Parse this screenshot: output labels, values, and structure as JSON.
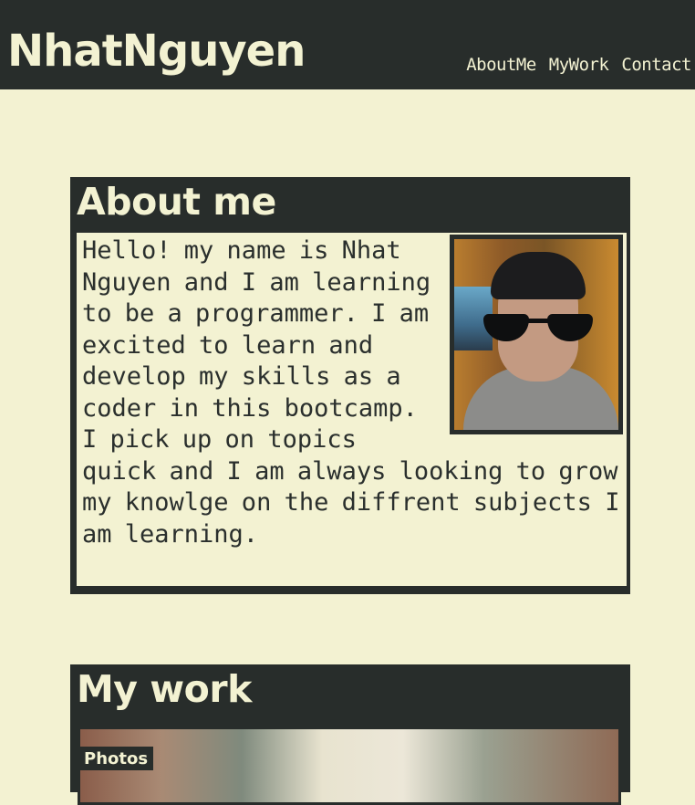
{
  "header": {
    "title": "NhatNguyen",
    "nav": [
      {
        "label": "AboutMe"
      },
      {
        "label": "MyWork"
      },
      {
        "label": "Contact"
      }
    ]
  },
  "about": {
    "heading": "About me",
    "text": "Hello! my name is Nhat Nguyen and I am learning to be a programmer. I am excited to learn and develop my skills as a coder in this bootcamp. I pick up on topics quick and I am always looking to grow my knowlge on the diffrent subjects I am learning."
  },
  "work": {
    "heading": "My work",
    "items": [
      {
        "label": "Photos"
      }
    ]
  },
  "colors": {
    "background": "#f3f2d2",
    "dark": "#282d2b"
  }
}
